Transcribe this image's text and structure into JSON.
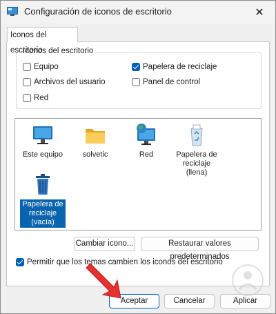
{
  "window": {
    "title": "Configuración de iconos de escritorio",
    "close_glyph": "✕"
  },
  "tab": {
    "label": "Iconos del escritorio"
  },
  "group": {
    "label": "Iconos del escritorio",
    "checkboxes": [
      {
        "label": "Equipo",
        "checked": false
      },
      {
        "label": "Archivos del usuario",
        "checked": false
      },
      {
        "label": "Red",
        "checked": false
      },
      {
        "label": "Papelera de reciclaje",
        "checked": true
      },
      {
        "label": "Panel de control",
        "checked": false
      }
    ]
  },
  "icons": [
    {
      "label": "Este equipo",
      "icon": "monitor-icon"
    },
    {
      "label": "solvetic",
      "icon": "folder-icon"
    },
    {
      "label": "Red",
      "icon": "network-icon"
    },
    {
      "label": "Papelera de reciclaje (llena)",
      "icon": "recycle-bin-full-icon"
    },
    {
      "label": "Papelera de reciclaje (vacía)",
      "icon": "recycle-bin-empty-icon",
      "selected": true
    }
  ],
  "buttons": {
    "change_icon": "Cambiar icono...",
    "restore_defaults": "Restaurar valores predeterminados",
    "accept": "Aceptar",
    "cancel": "Cancelar",
    "apply": "Aplicar"
  },
  "themes_checkbox": {
    "label": "Permitir que los temas cambien los iconos del escritorio",
    "checked": true
  },
  "colors": {
    "accent": "#005fb8",
    "selection": "#0a64ad",
    "arrow": "#e8312f"
  }
}
